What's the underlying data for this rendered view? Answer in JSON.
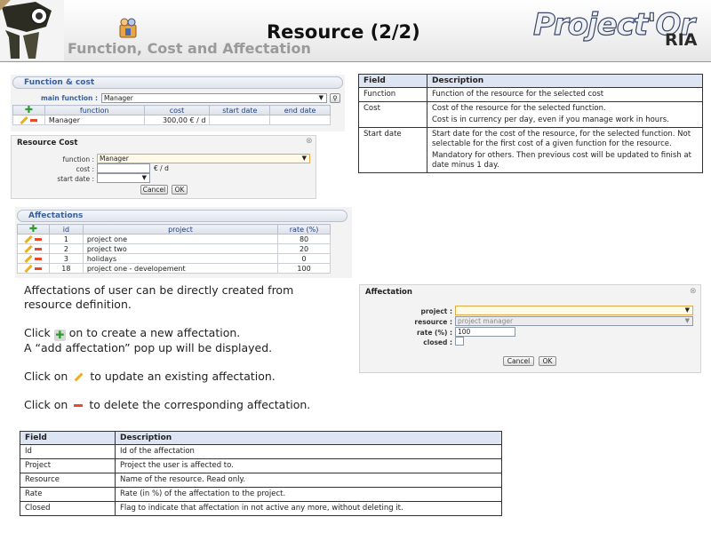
{
  "header": {
    "title": "Resource (2/2)",
    "subtitle": "Function, Cost and Affectation",
    "brand": "Project'Or",
    "brand_suffix": "RIA"
  },
  "function_cost": {
    "section_title": "Function & cost",
    "main_function_label": "main function :",
    "main_function_value": "Manager",
    "columns": [
      "function",
      "cost",
      "start date",
      "end date"
    ],
    "rows": [
      {
        "function": "Manager",
        "cost": "300,00 € / d",
        "start_date": "",
        "end_date": ""
      }
    ]
  },
  "resource_cost_dialog": {
    "title": "Resource Cost",
    "function_label": "function :",
    "function_value": "Manager",
    "cost_label": "cost :",
    "cost_unit": "€ / d",
    "start_date_label": "start date :",
    "cancel_label": "Cancel",
    "ok_label": "OK"
  },
  "affectations": {
    "section_title": "Affectations",
    "columns": [
      "id",
      "project",
      "rate (%)"
    ],
    "rows": [
      {
        "id": "1",
        "project": "project one",
        "rate": "80"
      },
      {
        "id": "2",
        "project": "project two",
        "rate": "20"
      },
      {
        "id": "3",
        "project": "holidays",
        "rate": "0"
      },
      {
        "id": "18",
        "project": "project one - developement",
        "rate": "100"
      }
    ]
  },
  "field_table_1": {
    "headers": [
      "Field",
      "Description"
    ],
    "rows": [
      {
        "field": "Function",
        "desc": [
          "Function of the resource for the selected cost"
        ]
      },
      {
        "field": "Cost",
        "desc": [
          "Cost of the resource for the selected function.",
          "Cost is in currency per day, even if you manage work in hours."
        ]
      },
      {
        "field": "Start date",
        "desc": [
          "Start date for the cost of the resource, for the selected function. Not selectable for the first cost of a given function for the resource.",
          "Mandatory for others. Then previous cost will be updated to finish at date minus 1 day."
        ]
      }
    ]
  },
  "instructions": {
    "line1": "Affectations of user can be directly created from resource definition.",
    "click_create_pre": "Click",
    "click_create_post": "on to create a new affectation.",
    "popup_note": "A “add affectation” pop up will be displayed.",
    "click_update_pre": "Click on",
    "click_update_post": "to update an existing affectation.",
    "click_delete_pre": "Click on",
    "click_delete_post": "to delete the corresponding affectation."
  },
  "affectation_dialog": {
    "title": "Affectation",
    "project_label": "project :",
    "project_value": "",
    "resource_label": "resource :",
    "resource_value": "project manager",
    "rate_label": "rate (%) :",
    "rate_value": "100",
    "closed_label": "closed :",
    "cancel_label": "Cancel",
    "ok_label": "OK"
  },
  "field_table_2": {
    "headers": [
      "Field",
      "Description"
    ],
    "rows": [
      {
        "field": "Id",
        "desc": "Id of the affectation"
      },
      {
        "field": "Project",
        "desc": "Project the user is affected to."
      },
      {
        "field": "Resource",
        "desc": "Name of the resource. Read only."
      },
      {
        "field": "Rate",
        "desc": "Rate (in %) of the affectation to the project."
      },
      {
        "field": "Closed",
        "desc": "Flag to indicate that affectation in not active any more, without deleting it."
      }
    ]
  }
}
